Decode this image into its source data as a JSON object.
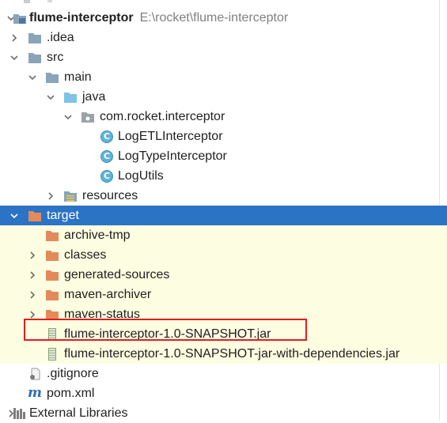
{
  "project": {
    "name": "flume-interceptor",
    "path": "E:\\rocket\\flume-interceptor"
  },
  "tree": [
    {
      "label": ".idea"
    },
    {
      "label": "src"
    },
    {
      "label": "main"
    },
    {
      "label": "java"
    },
    {
      "label": "com.rocket.interceptor"
    },
    {
      "label": "LogETLInterceptor",
      "badge": "C"
    },
    {
      "label": "LogTypeInterceptor",
      "badge": "C"
    },
    {
      "label": "LogUtils",
      "badge": "C"
    },
    {
      "label": "resources"
    },
    {
      "label": "target"
    },
    {
      "label": "archive-tmp"
    },
    {
      "label": "classes"
    },
    {
      "label": "generated-sources"
    },
    {
      "label": "maven-archiver"
    },
    {
      "label": "maven-status"
    },
    {
      "label": "flume-interceptor-1.0-SNAPSHOT.jar"
    },
    {
      "label": "flume-interceptor-1.0-SNAPSHOT-jar-with-dependencies.jar"
    },
    {
      "label": ".gitignore"
    },
    {
      "label": "pom.xml",
      "badge": "m"
    },
    {
      "label": "External Libraries"
    }
  ],
  "colors": {
    "selection": "#2b73c4",
    "excluded_background": "#fdfde2",
    "highlight_box": "#e01e1e",
    "folder": "#8aa4b8",
    "source_folder": "#7fc3e6",
    "excluded_folder": "#e48a5a"
  }
}
